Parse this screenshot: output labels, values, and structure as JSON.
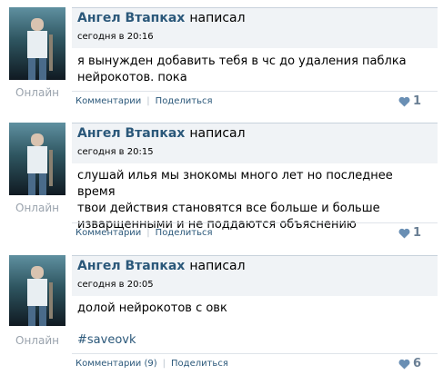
{
  "posts": [
    {
      "author": "Ангел Втапках",
      "action": "написал",
      "time": "сегодня в 20:16",
      "status": "Онлайн",
      "text_lines": [
        "я вынужден добавить тебя в чс до удаления паблка",
        "нейрокотов. пока"
      ],
      "hashtag": "",
      "comments_label": "Комментарии",
      "share_label": "Поделиться",
      "likes": "1"
    },
    {
      "author": "Ангел Втапках",
      "action": "написал",
      "time": "сегодня в 20:15",
      "status": "Онлайн",
      "text_lines": [
        "слушай илья мы знокомы много лет но последнее время",
        "твои действия становятся все больше и больше",
        "изварщенными и не поддаются объяснению"
      ],
      "hashtag": "",
      "comments_label": "Комментарии",
      "share_label": "Поделиться",
      "likes": "1"
    },
    {
      "author": "Ангел Втапках",
      "action": "написал",
      "time": "сегодня в 20:05",
      "status": "Онлайн",
      "text_lines": [
        "долой нейрокотов с овк"
      ],
      "hashtag": "#saveovk",
      "comments_label": "Комментарии (9)",
      "share_label": "Поделиться",
      "likes": "6"
    }
  ],
  "colors": {
    "link": "#2b587a",
    "card_bg": "#f0f3f6",
    "muted": "#9aa3ad",
    "heart": "#6a8fb4"
  }
}
